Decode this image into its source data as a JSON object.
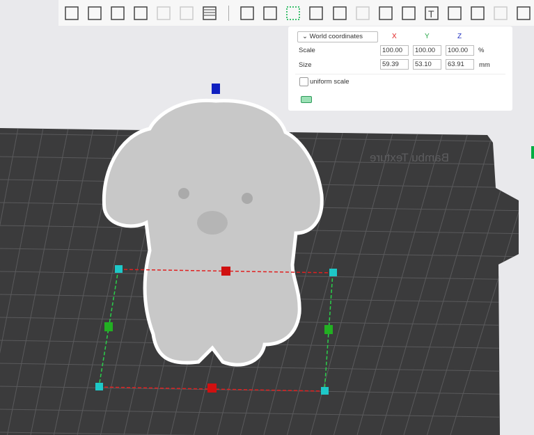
{
  "toolbar": {
    "items": [
      "add-object",
      "add-plate",
      "auto-orient",
      "arrange",
      "plate-0",
      "plate-p",
      "layers",
      "move",
      "rotate",
      "scale",
      "lay-on-face",
      "cut",
      "boolean",
      "support-paint",
      "seam-paint",
      "text",
      "color-paint",
      "measure",
      "assembly",
      "more"
    ]
  },
  "scale_panel": {
    "coordinate_mode": "World coordinates",
    "axes": {
      "x": "X",
      "y": "Y",
      "z": "Z"
    },
    "scale": {
      "label": "Scale",
      "x": "100.00",
      "y": "100.00",
      "z": "100.00",
      "unit": "%"
    },
    "size": {
      "label": "Size",
      "x": "59.39",
      "y": "53.10",
      "z": "63.91",
      "unit": "mm"
    },
    "uniform_scale_label": "uniform scale",
    "uniform_scale_checked": false
  },
  "plate": {
    "texture_text": "Bambu Texture"
  },
  "colors": {
    "x_axis": "#e02020",
    "y_axis": "#2aa84a",
    "z_axis": "#2030c0",
    "plate": "#3b3b3c",
    "model": "#c9c9c9",
    "accent": "#00ae42"
  }
}
